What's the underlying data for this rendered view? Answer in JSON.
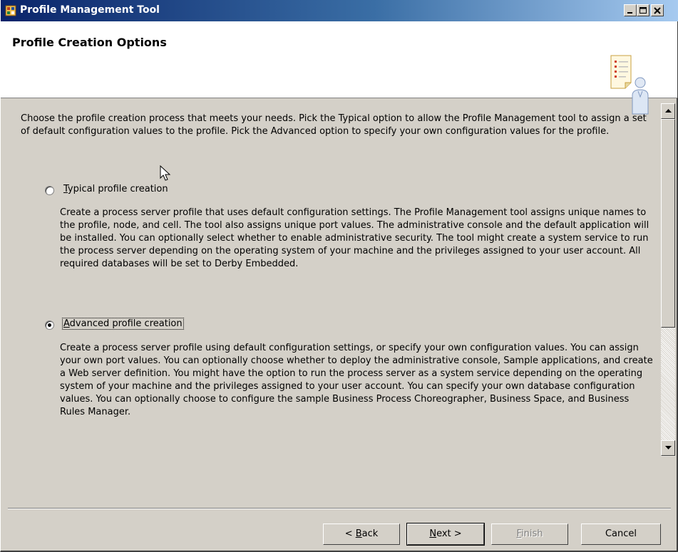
{
  "window": {
    "title": "Profile Management Tool",
    "buttons": [
      "minimize",
      "maximize",
      "close"
    ]
  },
  "banner": {
    "title": "Profile Creation Options",
    "icon": "profile-document-person-icon"
  },
  "intro_text": "Choose the profile creation process that meets your needs. Pick the Typical option to allow the Profile Management tool to assign a set of default configuration values to the profile. Pick the Advanced option to specify your own configuration values for the profile.",
  "options": [
    {
      "mnemonic": "T",
      "label_rest": "ypical profile creation",
      "selected": false,
      "description": "Create a process server profile that uses default configuration settings. The Profile Management tool assigns unique names to the profile, node, and cell. The tool also assigns unique port values. The administrative console and the default application will be installed. You can optionally select whether to enable administrative security. The tool might create a system service to run the process server depending on the operating system of your machine and the privileges assigned to your user account. All required databases will be set to Derby Embedded."
    },
    {
      "mnemonic": "A",
      "label_rest": "dvanced profile creation",
      "selected": true,
      "description": "Create a process server profile using default configuration settings, or specify your own configuration values. You can assign your own port values. You can optionally choose whether to deploy the administrative console, Sample applications, and create a Web server definition. You might have the option to run the process server as a system service depending on the operating system of your machine and the privileges assigned to your user account. You can specify your own database configuration values. You can optionally choose to configure the sample Business Process Choreographer, Business Space, and Business Rules Manager."
    }
  ],
  "footer": {
    "back": {
      "prefix": "< ",
      "mnemonic": "B",
      "rest": "ack"
    },
    "next": {
      "mnemonic": "N",
      "rest": "ext >"
    },
    "finish": {
      "mnemonic": "F",
      "rest": "inish",
      "enabled": false
    },
    "cancel": {
      "label": "Cancel"
    }
  }
}
